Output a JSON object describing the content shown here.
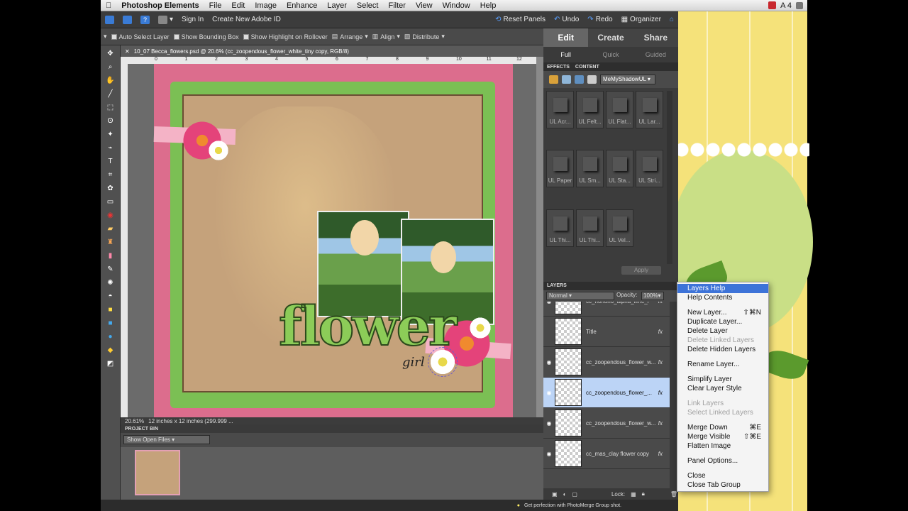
{
  "menubar": {
    "app": "Photoshop Elements",
    "items": [
      "File",
      "Edit",
      "Image",
      "Enhance",
      "Layer",
      "Select",
      "Filter",
      "View",
      "Window",
      "Help"
    ],
    "status": "A 4"
  },
  "topbar": {
    "sign_in": "Sign In",
    "create_id": "Create New Adobe ID",
    "reset_panels": "Reset Panels",
    "undo": "Undo",
    "redo": "Redo",
    "organizer": "Organizer"
  },
  "options": {
    "auto_select": "Auto Select Layer",
    "bounding_box": "Show Bounding Box",
    "highlight": "Show Highlight on Rollover",
    "arrange": "Arrange",
    "align": "Align",
    "distribute": "Distribute"
  },
  "document": {
    "tab_title": "10_07 Becca_flowers.psd @ 20.6% (cc_zoopendous_flower_white_tiny copy, RGB/8)",
    "ruler_ticks": [
      "0",
      "1",
      "2",
      "3",
      "4",
      "5",
      "6",
      "7",
      "8",
      "9",
      "10",
      "11",
      "12"
    ],
    "zoom": "20.61%",
    "doc_info": "12 inches x 12 inches (299.999 ...",
    "page_title_word": "flower",
    "page_sub_word": "girl"
  },
  "project_bin": {
    "header": "PROJECT BIN",
    "dropdown": "Show Open Files"
  },
  "footer": {
    "tip": "Get perfection with PhotoMerge Group shot."
  },
  "mode_tabs": [
    "Edit",
    "Create",
    "Share"
  ],
  "sub_tabs": [
    "Full",
    "Quick",
    "Guided"
  ],
  "effects": {
    "tabs": [
      "EFFECTS",
      "CONTENT"
    ],
    "library": "MeMyShadowUL",
    "items": [
      "UL Acr...",
      "UL Felt...",
      "UL Flat...",
      "UL Lar...",
      "UL Paper",
      "UL Sm...",
      "UL Sta...",
      "UL Stri...",
      "UL Thi...",
      "UL Thi...",
      "UL Vel..."
    ],
    "apply": "Apply"
  },
  "layers": {
    "header": "LAYERS",
    "blend": "Normal",
    "opacity_label": "Opacity:",
    "opacity": "100%",
    "lock_label": "Lock:",
    "rows": [
      {
        "name": "cc_hohoho_alpha_lime_r",
        "eye": true
      },
      {
        "name": "Title",
        "eye": false
      },
      {
        "name": "cc_zoopendous_flower_w...",
        "eye": true
      },
      {
        "name": "cc_zoopendous_flower_...",
        "eye": true
      },
      {
        "name": "cc_zoopendous_flower_w...",
        "eye": true
      },
      {
        "name": "cc_mas_clay flower copy",
        "eye": true
      }
    ]
  },
  "layers_menu": [
    {
      "label": "Layers Help",
      "shortcut": "",
      "state": "highlight"
    },
    {
      "label": "Help Contents",
      "shortcut": "",
      "state": "normal"
    },
    {
      "sep": true
    },
    {
      "label": "New Layer...",
      "shortcut": "⇧⌘N",
      "state": "normal"
    },
    {
      "label": "Duplicate Layer...",
      "shortcut": "",
      "state": "normal"
    },
    {
      "label": "Delete Layer",
      "shortcut": "",
      "state": "normal"
    },
    {
      "label": "Delete Linked Layers",
      "shortcut": "",
      "state": "disabled"
    },
    {
      "label": "Delete Hidden Layers",
      "shortcut": "",
      "state": "normal"
    },
    {
      "sep": true
    },
    {
      "label": "Rename Layer...",
      "shortcut": "",
      "state": "normal"
    },
    {
      "sep": true
    },
    {
      "label": "Simplify Layer",
      "shortcut": "",
      "state": "normal"
    },
    {
      "label": "Clear Layer Style",
      "shortcut": "",
      "state": "normal"
    },
    {
      "sep": true
    },
    {
      "label": "Link Layers",
      "shortcut": "",
      "state": "disabled"
    },
    {
      "label": "Select Linked Layers",
      "shortcut": "",
      "state": "disabled"
    },
    {
      "sep": true
    },
    {
      "label": "Merge Down",
      "shortcut": "⌘E",
      "state": "normal"
    },
    {
      "label": "Merge Visible",
      "shortcut": "⇧⌘E",
      "state": "normal"
    },
    {
      "label": "Flatten Image",
      "shortcut": "",
      "state": "normal"
    },
    {
      "sep": true
    },
    {
      "label": "Panel Options...",
      "shortcut": "",
      "state": "normal"
    },
    {
      "sep": true
    },
    {
      "label": "Close",
      "shortcut": "",
      "state": "normal"
    },
    {
      "label": "Close Tab Group",
      "shortcut": "",
      "state": "normal"
    }
  ]
}
